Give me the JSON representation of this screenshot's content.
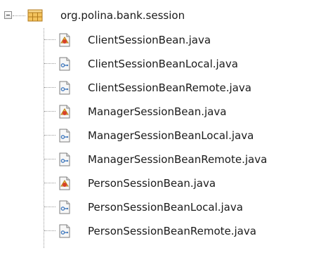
{
  "tree": {
    "package": {
      "label": "org.polina.bank.session",
      "icon": "package-icon",
      "expanded": true
    },
    "files": [
      {
        "label": "ClientSessionBean.java",
        "icon": "session-bean-icon"
      },
      {
        "label": "ClientSessionBeanLocal.java",
        "icon": "interface-icon"
      },
      {
        "label": "ClientSessionBeanRemote.java",
        "icon": "interface-icon"
      },
      {
        "label": "ManagerSessionBean.java",
        "icon": "session-bean-icon"
      },
      {
        "label": "ManagerSessionBeanLocal.java",
        "icon": "interface-icon"
      },
      {
        "label": "ManagerSessionBeanRemote.java",
        "icon": "interface-icon"
      },
      {
        "label": "PersonSessionBean.java",
        "icon": "session-bean-icon"
      },
      {
        "label": "PersonSessionBeanLocal.java",
        "icon": "interface-icon"
      },
      {
        "label": "PersonSessionBeanRemote.java",
        "icon": "interface-icon"
      }
    ]
  },
  "colors": {
    "package_fill": "#f0b84a",
    "bean_accent": "#d8402a",
    "interface_accent": "#4a7fc0"
  }
}
